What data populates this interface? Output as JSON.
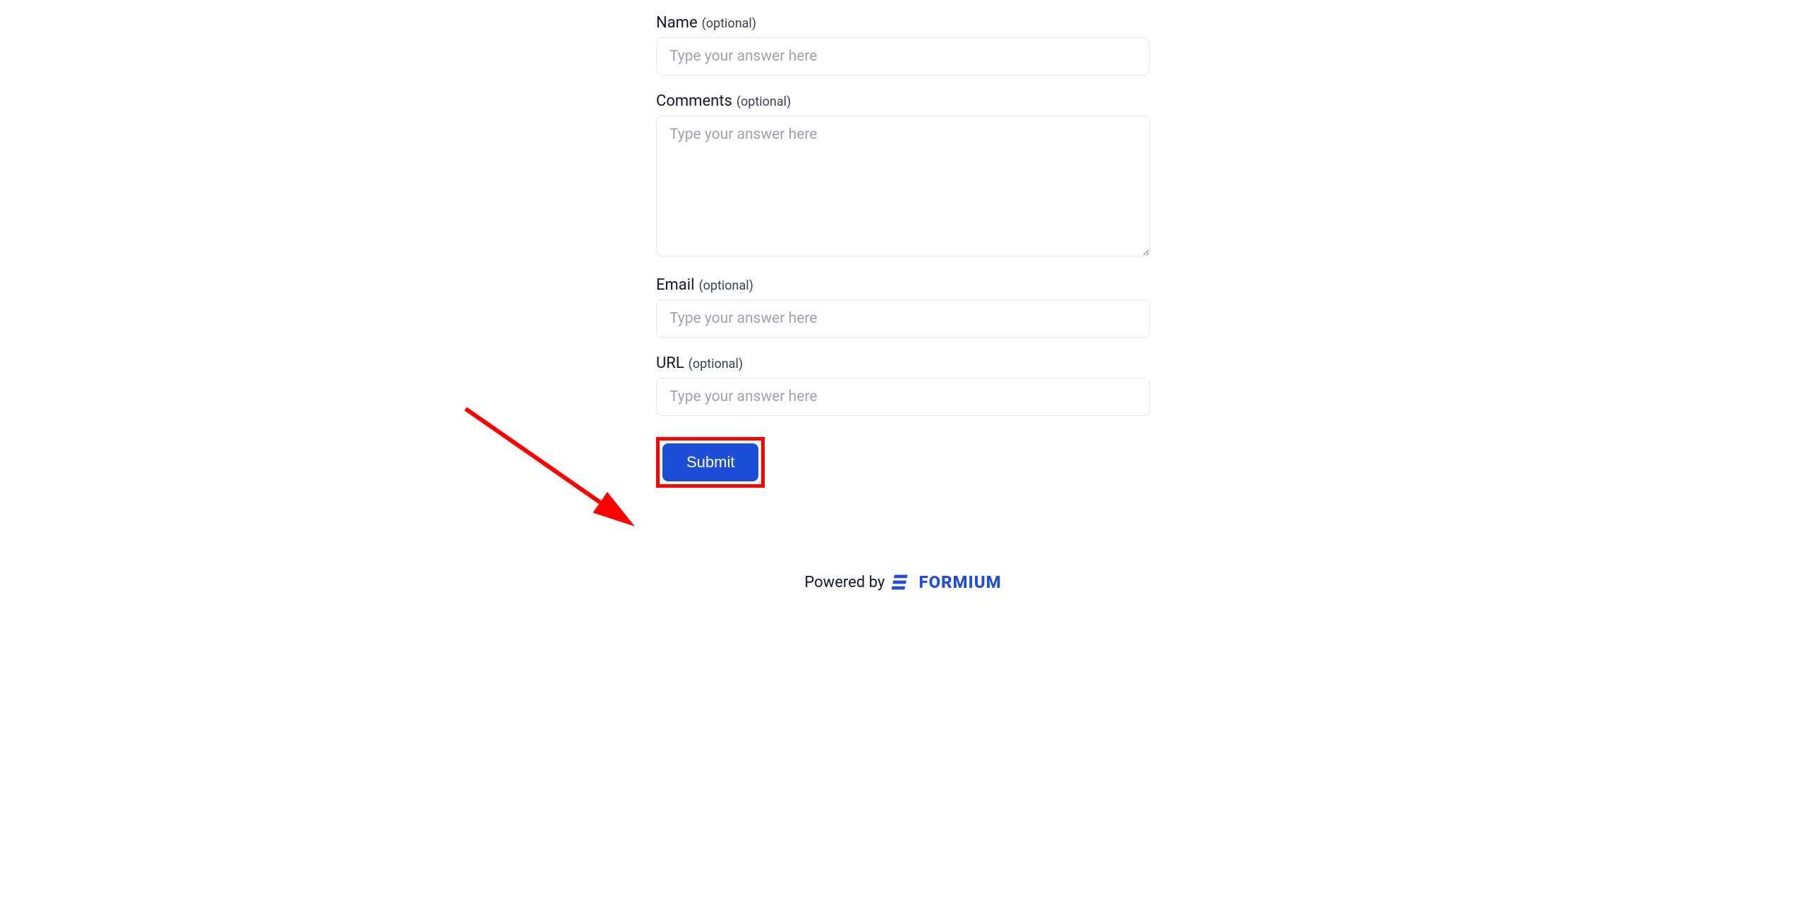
{
  "fields": {
    "name": {
      "label": "Name",
      "hint": "(optional)",
      "placeholder": "Type your answer here",
      "value": ""
    },
    "comments": {
      "label": "Comments",
      "hint": "(optional)",
      "placeholder": "Type your answer here",
      "value": ""
    },
    "email": {
      "label": "Email",
      "hint": "(optional)",
      "placeholder": "Type your answer here",
      "value": ""
    },
    "url": {
      "label": "URL",
      "hint": "(optional)",
      "placeholder": "Type your answer here",
      "value": ""
    }
  },
  "submit": {
    "label": "Submit"
  },
  "footer": {
    "prefix": "Powered by",
    "brand": "FORMIUM"
  },
  "annotation": {
    "highlight_color": "#ff0000"
  }
}
